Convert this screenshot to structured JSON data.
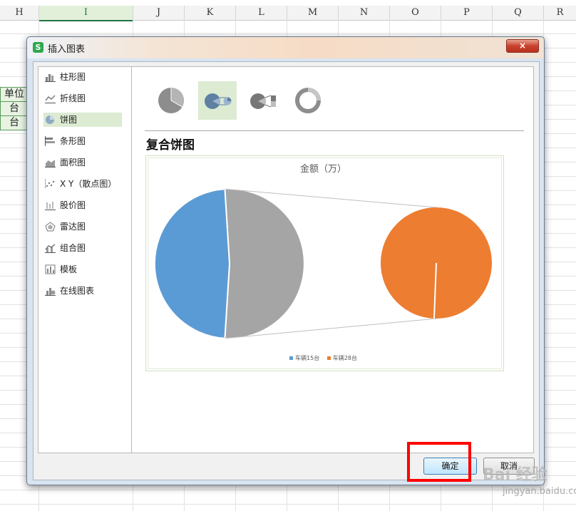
{
  "spreadsheet": {
    "columns": [
      "H",
      "I",
      "J",
      "K",
      "L",
      "M",
      "N",
      "O",
      "P",
      "Q",
      "R"
    ],
    "selected_column": "I",
    "cells": [
      "单位",
      "台",
      "台"
    ]
  },
  "dialog": {
    "title": "插入图表",
    "app_icon_letter": "S",
    "close_symbol": "×",
    "sidebar": {
      "items": [
        {
          "label": "柱形图",
          "icon": "column-chart-icon"
        },
        {
          "label": "折线图",
          "icon": "line-chart-icon"
        },
        {
          "label": "饼图",
          "icon": "pie-chart-icon",
          "active": true
        },
        {
          "label": "条形图",
          "icon": "bar-chart-icon"
        },
        {
          "label": "面积图",
          "icon": "area-chart-icon"
        },
        {
          "label": "X Y（散点图）",
          "icon": "scatter-chart-icon"
        },
        {
          "label": "股价图",
          "icon": "stock-chart-icon"
        },
        {
          "label": "雷达图",
          "icon": "radar-chart-icon"
        },
        {
          "label": "组合图",
          "icon": "combo-chart-icon"
        },
        {
          "label": "模板",
          "icon": "template-icon"
        },
        {
          "label": "在线图表",
          "icon": "online-chart-icon"
        }
      ]
    },
    "subtypes": [
      {
        "name": "pie",
        "icon": "pie-subtype-icon"
      },
      {
        "name": "pie-of-pie",
        "icon": "pie-of-pie-subtype-icon",
        "active": true
      },
      {
        "name": "bar-of-pie",
        "icon": "bar-of-pie-subtype-icon"
      },
      {
        "name": "doughnut",
        "icon": "doughnut-subtype-icon"
      }
    ],
    "subtype_title": "复合饼图",
    "ok_label": "确定",
    "cancel_label": "取消"
  },
  "chart_data": {
    "type": "pie",
    "subtype": "pie-of-pie",
    "title": "金额（万）",
    "legend_position": "bottom",
    "slices": [
      {
        "name": "车辆15台",
        "value": 48,
        "color": "#5b9bd5",
        "plot": "main"
      },
      {
        "name": "车辆28台",
        "value": 52,
        "color": "#ed7d31",
        "plot": "secondary"
      }
    ],
    "other_color": "#a5a5a5"
  },
  "watermark": {
    "text": "Bai 经验",
    "url": "jingyan.baidu.com"
  }
}
